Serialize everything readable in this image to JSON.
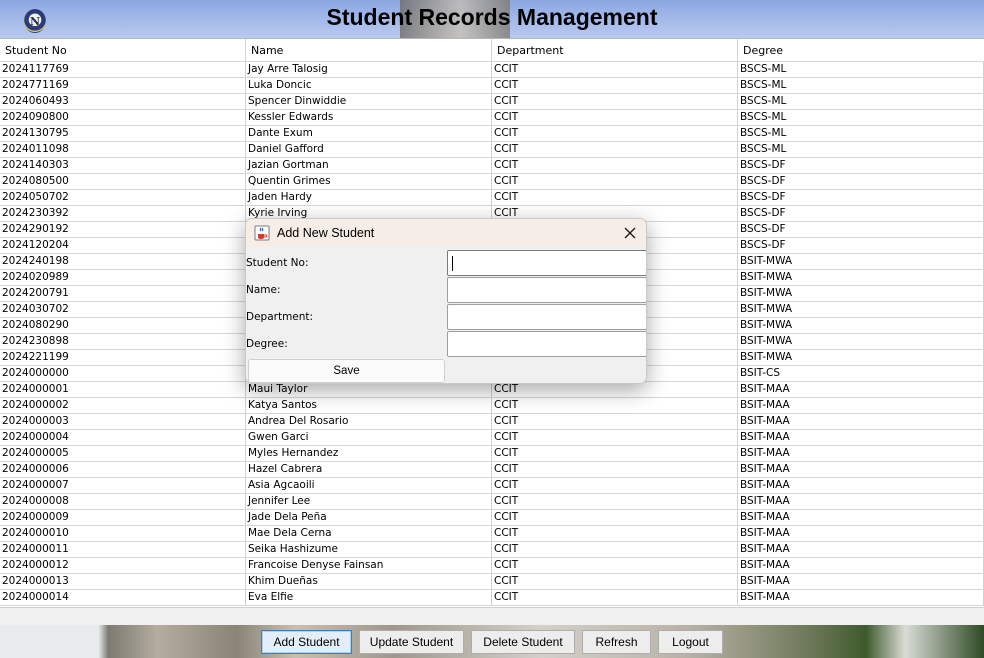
{
  "app": {
    "title": "Student Records Management",
    "logo_letter": "N"
  },
  "table": {
    "headers": [
      "Student No",
      "Name",
      "Department",
      "Degree"
    ],
    "rows": [
      [
        "2024117769",
        "Jay Arre Talosig",
        "CCIT",
        "BSCS-ML"
      ],
      [
        "2024771169",
        "Luka Doncic",
        "CCIT",
        "BSCS-ML"
      ],
      [
        "2024060493",
        "Spencer Dinwiddie",
        "CCIT",
        "BSCS-ML"
      ],
      [
        "2024090800",
        "Kessler Edwards",
        "CCIT",
        "BSCS-ML"
      ],
      [
        "2024130795",
        "Dante Exum",
        "CCIT",
        "BSCS-ML"
      ],
      [
        "2024011098",
        "Daniel Gafford",
        "CCIT",
        "BSCS-ML"
      ],
      [
        "2024140303",
        "Jazian Gortman",
        "CCIT",
        "BSCS-DF"
      ],
      [
        "2024080500",
        "Quentin Grimes",
        "CCIT",
        "BSCS-DF"
      ],
      [
        "2024050702",
        "Jaden Hardy",
        "CCIT",
        "BSCS-DF"
      ],
      [
        "2024230392",
        "Kyrie Irving",
        "CCIT",
        "BSCS-DF"
      ],
      [
        "2024290192",
        "",
        "",
        "BSCS-DF"
      ],
      [
        "2024120204",
        "",
        "",
        "BSCS-DF"
      ],
      [
        "2024240198",
        "",
        "",
        "BSIT-MWA"
      ],
      [
        "2024020989",
        "",
        "",
        "BSIT-MWA"
      ],
      [
        "2024200791",
        "",
        "",
        "BSIT-MWA"
      ],
      [
        "2024030702",
        "",
        "",
        "BSIT-MWA"
      ],
      [
        "2024080290",
        "",
        "",
        "BSIT-MWA"
      ],
      [
        "2024230898",
        "",
        "",
        "BSIT-MWA"
      ],
      [
        "2024221199",
        "",
        "",
        "BSIT-MWA"
      ],
      [
        "2024000000",
        "",
        "",
        "BSIT-CS"
      ],
      [
        "2024000001",
        "Maui Taylor",
        "CCIT",
        "BSIT-MAA"
      ],
      [
        "2024000002",
        "Katya Santos",
        "CCIT",
        "BSIT-MAA"
      ],
      [
        "2024000003",
        "Andrea Del Rosario",
        "CCIT",
        "BSIT-MAA"
      ],
      [
        "2024000004",
        "Gwen Garci",
        "CCIT",
        "BSIT-MAA"
      ],
      [
        "2024000005",
        "Myles Hernandez",
        "CCIT",
        "BSIT-MAA"
      ],
      [
        "2024000006",
        "Hazel Cabrera",
        "CCIT",
        "BSIT-MAA"
      ],
      [
        "2024000007",
        "Asia Agcaoili",
        "CCIT",
        "BSIT-MAA"
      ],
      [
        "2024000008",
        "Jennifer Lee",
        "CCIT",
        "BSIT-MAA"
      ],
      [
        "2024000009",
        "Jade Dela Peña",
        "CCIT",
        "BSIT-MAA"
      ],
      [
        "2024000010",
        "Mae Dela Cerna",
        "CCIT",
        "BSIT-MAA"
      ],
      [
        "2024000011",
        "Seika Hashizume",
        "CCIT",
        "BSIT-MAA"
      ],
      [
        "2024000012",
        "Francoise Denyse Fainsan",
        "CCIT",
        "BSIT-MAA"
      ],
      [
        "2024000013",
        "Khim Dueñas",
        "CCIT",
        "BSIT-MAA"
      ],
      [
        "2024000014",
        "Eva Elfie",
        "CCIT",
        "BSIT-MAA"
      ]
    ]
  },
  "buttons": {
    "add": "Add Student",
    "update": "Update Student",
    "delete": "Delete Student",
    "refresh": "Refresh",
    "logout": "Logout"
  },
  "dialog": {
    "title": "Add New Student",
    "icons": {
      "app": "java-cup-icon",
      "close": "close-icon"
    },
    "fields": {
      "student_no": {
        "label": "Student No:",
        "value": ""
      },
      "name": {
        "label": "Name:",
        "value": ""
      },
      "department": {
        "label": "Department:",
        "value": ""
      },
      "degree": {
        "label": "Degree:",
        "value": ""
      }
    },
    "save_label": "Save"
  },
  "colors": {
    "active_button_border": "#3c7fb1",
    "dialog_title_bg": "#f5ede6",
    "header_sky": "#9fb6e8"
  }
}
